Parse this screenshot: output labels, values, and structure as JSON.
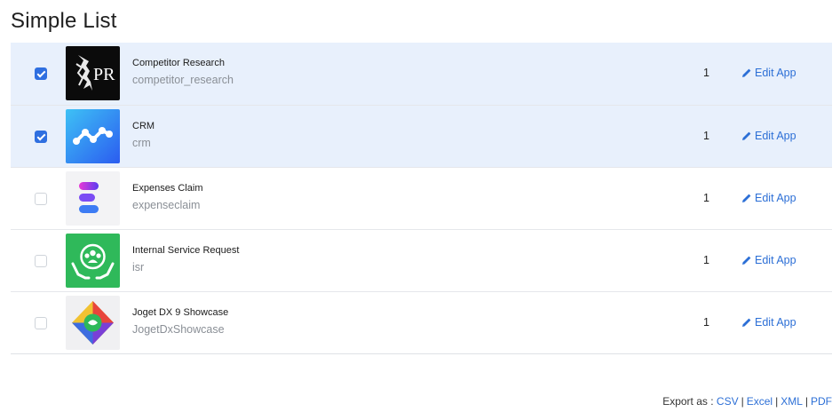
{
  "page": {
    "title": "Simple List"
  },
  "rows": [
    {
      "name": "Competitor Research",
      "id": "competitor_research",
      "count": "1",
      "action": "Edit App",
      "checked": true,
      "icon": "pr-lion-icon"
    },
    {
      "name": "CRM",
      "id": "crm",
      "count": "1",
      "action": "Edit App",
      "checked": true,
      "icon": "crm-wave-icon"
    },
    {
      "name": "Expenses Claim",
      "id": "expenseclaim",
      "count": "1",
      "action": "Edit App",
      "checked": false,
      "icon": "expense-e-icon"
    },
    {
      "name": "Internal Service Request",
      "id": "isr",
      "count": "1",
      "action": "Edit App",
      "checked": false,
      "icon": "service-hands-icon"
    },
    {
      "name": "Joget DX 9 Showcase",
      "id": "JogetDxShowcase",
      "count": "1",
      "action": "Edit App",
      "checked": false,
      "icon": "joget-showcase-icon"
    }
  ],
  "export": {
    "label": "Export as :",
    "formats": [
      "CSV",
      "Excel",
      "XML",
      "PDF"
    ]
  },
  "colors": {
    "selected_row": "#e8f0fc",
    "link": "#2c6fd6",
    "checkbox_checked": "#2f6fe0"
  }
}
